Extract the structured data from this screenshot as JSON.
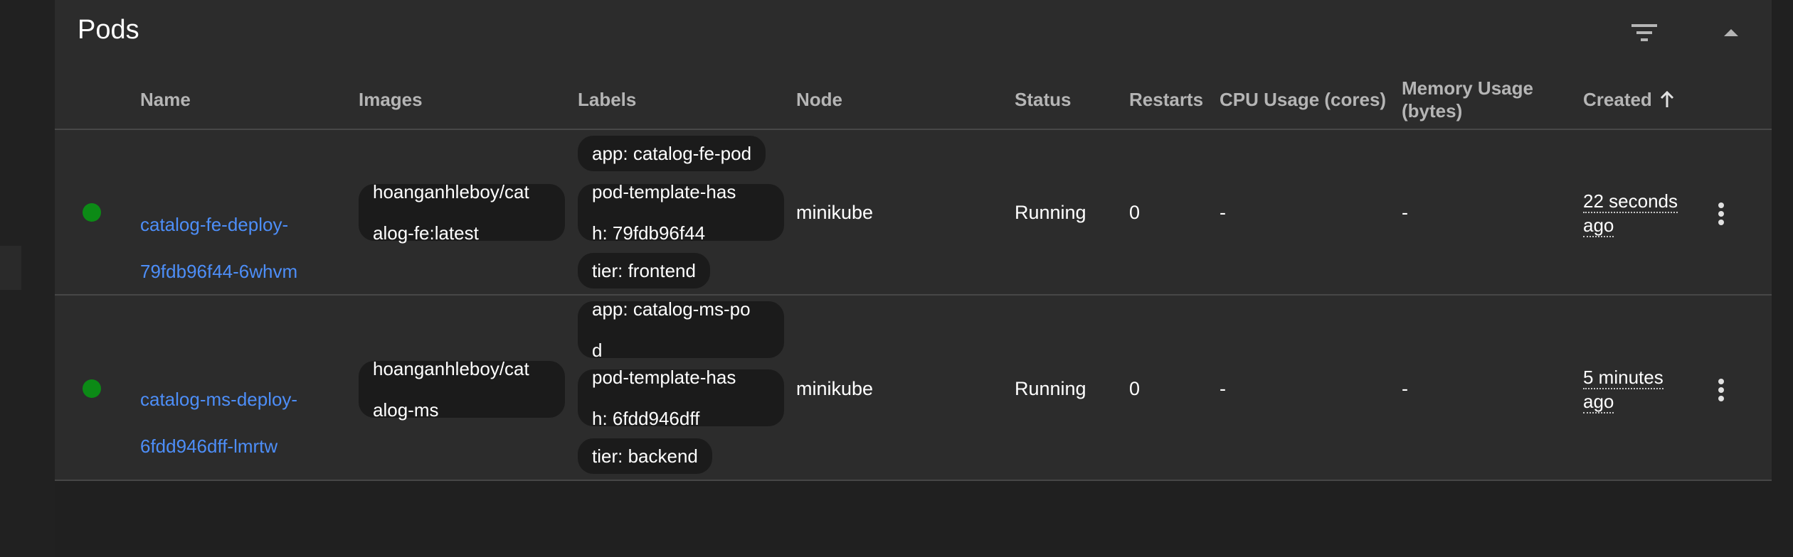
{
  "card": {
    "title": "Pods"
  },
  "table": {
    "headers": {
      "name": "Name",
      "images": "Images",
      "labels": "Labels",
      "node": "Node",
      "status": "Status",
      "restarts": "Restarts",
      "cpu": "CPU Usage (cores)",
      "memory_line1": "Memory Usage",
      "memory_line2": "(bytes)",
      "created": "Created"
    },
    "rows": [
      {
        "status_color": "#0c8a16",
        "name_line1": "catalog-fe-deploy-",
        "name_line2": "79fdb96f44-6whvm",
        "image_line1": "hoanganhleboy/cat",
        "image_line2": "alog-fe:latest",
        "label1": "app: catalog-fe-pod",
        "label2_line1": "pod-template-has",
        "label2_line2": "h: 79fdb96f44",
        "label3": "tier: frontend",
        "node": "minikube",
        "status": "Running",
        "restarts": "0",
        "cpu": "-",
        "memory": "-",
        "created_line1": "22 seconds",
        "created_line2": "ago"
      },
      {
        "status_color": "#0c8a16",
        "name_line1": "catalog-ms-deploy-",
        "name_line2": "6fdd946dff-lmrtw",
        "image_line1": "hoanganhleboy/cat",
        "image_line2": "alog-ms",
        "label1_line1": "app: catalog-ms-po",
        "label1_line2": "d",
        "label2_line1": "pod-template-has",
        "label2_line2": "h: 6fdd946dff",
        "label3": "tier: backend",
        "node": "minikube",
        "status": "Running",
        "restarts": "0",
        "cpu": "-",
        "memory": "-",
        "created_line1": "5 minutes",
        "created_line2": "ago"
      }
    ]
  },
  "icons": {
    "filter": "filter-icon",
    "collapse": "chevron-up-icon",
    "sort": "arrow-up-icon",
    "menu": "more-vertical-icon"
  },
  "colors": {
    "background": "#202020",
    "card": "#2c2c2c",
    "link": "#4d8ef8",
    "status_running": "#0c8a16",
    "chip": "#1b1b1b"
  }
}
